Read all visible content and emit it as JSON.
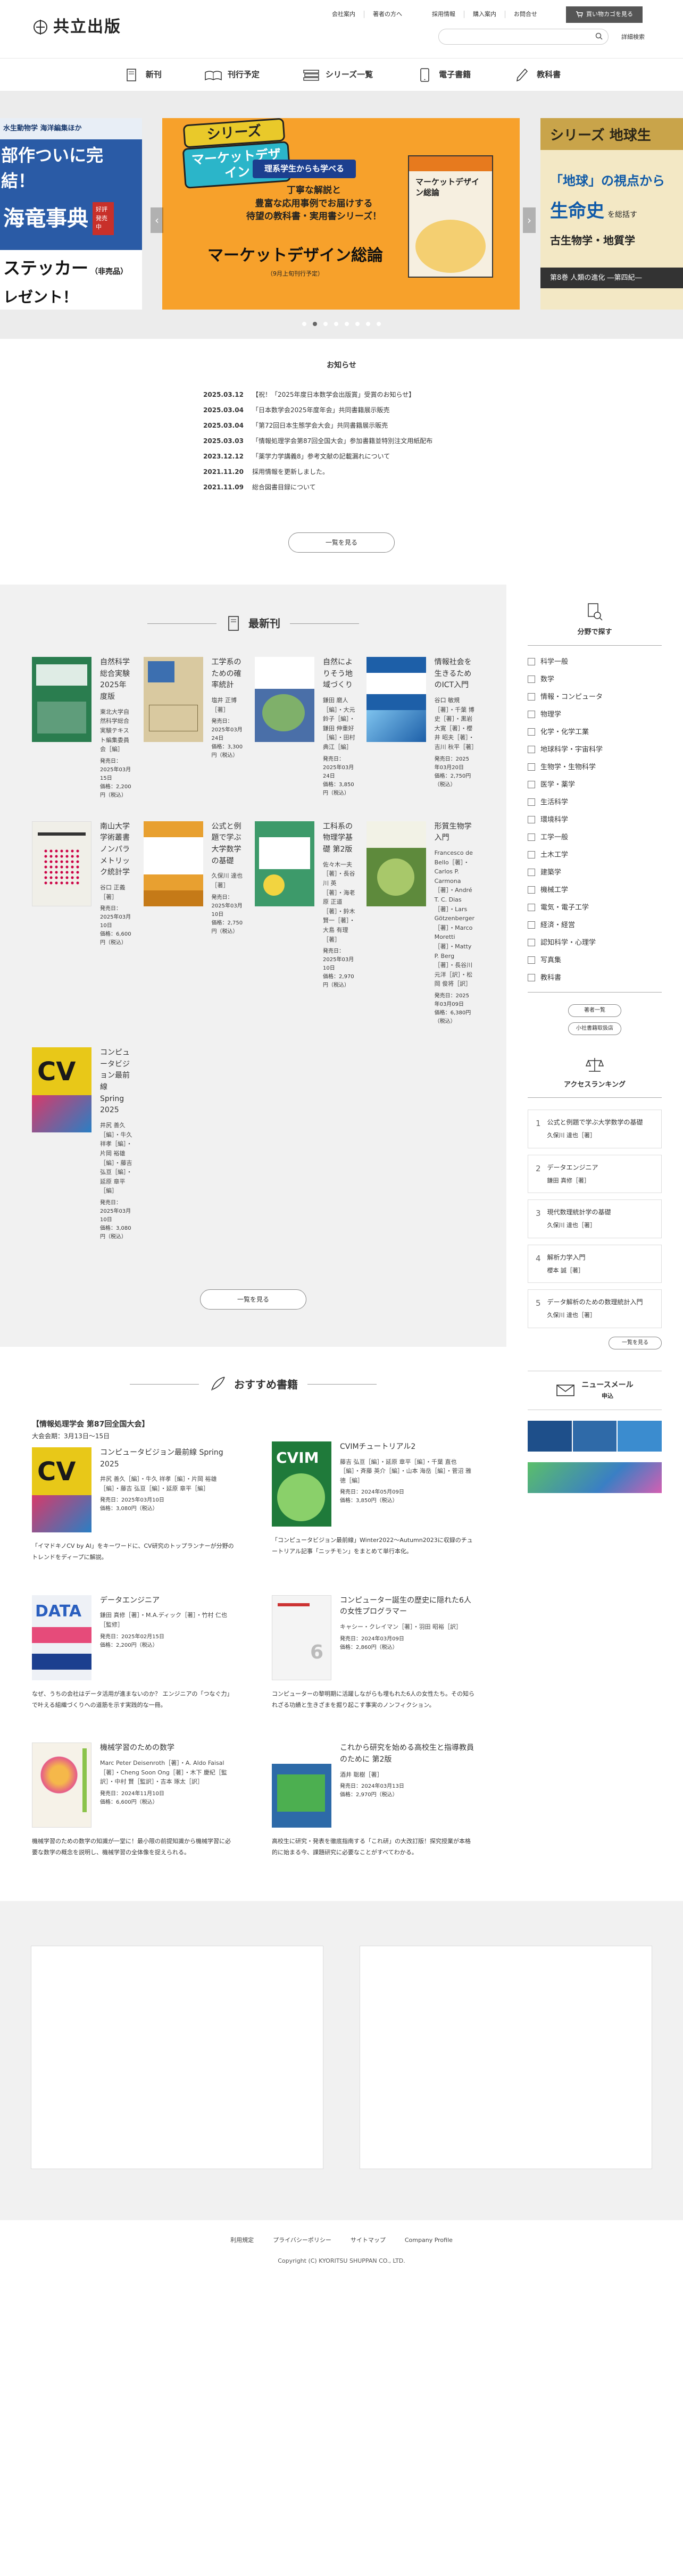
{
  "brand": {
    "name": "共立出版"
  },
  "topnav": {
    "group1": [
      "会社案内",
      "著者の方へ"
    ],
    "group2": [
      "採用情報",
      "購入案内",
      "お問合せ"
    ],
    "cart": "買い物カゴを見る"
  },
  "search": {
    "placeholder": "",
    "detail": "詳細検索"
  },
  "mainnav": [
    "新刊",
    "刊行予定",
    "シリーズ一覧",
    "電子書籍",
    "教科書"
  ],
  "slider": {
    "main": {
      "series_label": "シリーズ",
      "series_name": "マーケットデザイン",
      "tagline": "理系学生からも学べる",
      "desc1": "丁寧な解説と",
      "desc2": "豊富な応用事例でお届けする",
      "desc3": "待望の教科書・実用書シリーズ！",
      "title": "マーケットデザイン総論",
      "note": "（9月上旬刊行予定）",
      "book_title": "マーケットデザイン総論"
    },
    "left": {
      "line1": "水生動物学 海洋編集ほか",
      "line2": "部作ついに完結！",
      "line3": "海竜事典",
      "badge": "好評発売中",
      "line4": "ステッカー",
      "line4b": "（非売品）",
      "line5": "レゼント！"
    },
    "right": {
      "title": "シリーズ 地球生",
      "l1": "「地球」の視点から",
      "l2": "生命史",
      "l3": "を総括す",
      "l4": "古生物学・地質学",
      "l5": "第8巻 人類の進化 ―第四紀―"
    },
    "prev": "‹",
    "next": "›"
  },
  "news": {
    "title": "お知らせ",
    "items": [
      {
        "date": "2025.03.12",
        "text": "【祝！「2025年度日本数学会出版賞」受賞のお知らせ】"
      },
      {
        "date": "2025.03.04",
        "text": "「日本数学会2025年度年会」共同書籍展示販売"
      },
      {
        "date": "2025.03.04",
        "text": "「第72回日本生態学会大会」共同書籍展示販売"
      },
      {
        "date": "2025.03.03",
        "text": "「情報処理学会第87回全国大会」参加書籍並特別注文用紙配布"
      },
      {
        "date": "2023.12.12",
        "text": "「薬学力学講義8」参考文献の記載漏れについて"
      },
      {
        "date": "2021.11.20",
        "text": "採用情報を更新しました。"
      },
      {
        "date": "2021.11.09",
        "text": "総合図書目録について"
      }
    ],
    "more": "一覧を見る"
  },
  "newbooks": {
    "title": "最新刊",
    "more": "一覧を見る",
    "items": [
      {
        "title": "自然科学総合実験 2025年度版",
        "author": "東北大学自然科学総合実験テキスト編集委員会［編］",
        "date": "発売日：2025年03月15日",
        "price": "価格：2,200円（税込）",
        "cover": "#2a7d4f"
      },
      {
        "title": "工学系のための確率統計",
        "author": "塩井 正博［著］",
        "date": "発売日：2025年03月24日",
        "price": "価格：3,300円（税込）",
        "cover": "#d9c9a0"
      },
      {
        "title": "自然によりそう地域づくり",
        "author": "鎌田 磨人［編］・大元 鈴子［編］・鎌田 伸重好［編］・田村 典江［編］",
        "date": "発売日：2025年03月24日",
        "price": "価格：3,850円（税込）",
        "cover": "#4a6fa8"
      },
      {
        "title": "情報社会を生きるためのICT入門",
        "author": "谷口 敏規［著］・千葉 博史［著］・黒岩 大寛［著］・櫻井 昭夫［著］・吉川 秋平［著］",
        "date": "発売日：2025年03月20日",
        "price": "価格：2,750円（税込）",
        "cover": "#1d5fa8"
      },
      {
        "title": "南山大学学術叢書 ノンパラメトリック統計学",
        "author": "谷口 正義［著］",
        "date": "発売日：2025年03月10日",
        "price": "価格：6,600円（税込）",
        "cover": "#f0efe8"
      },
      {
        "title": "公式と例題で学ぶ大学数学の基礎",
        "author": "久保川 達也［著］",
        "date": "発売日：2025年03月10日",
        "price": "価格：2,750円（税込）",
        "cover": "#e8a030"
      },
      {
        "title": "工科系の物理学基礎 第2版",
        "author": "佐々木一夫［著］・長谷川 英［著］・海老原 正道［著］・鈴木 賢一［著］・大島 有理［著］",
        "date": "発売日：2025年03月10日",
        "price": "価格：2,970円（税込）",
        "cover": "#3d9a6a"
      },
      {
        "title": "形質生物学入門",
        "author": "Francesco de Bello［著］・Carlos P. Carmona［著］・André T. C. Dias［著］・Lars Götzenberger［著］・Marco Moretti［著］・Matty P. Berg［著］・長谷川 元洋［訳］・松岡 俊将［訳］",
        "date": "発売日：2025年03月09日",
        "price": "価格：6,380円（税込）",
        "cover": "#5e8a3c"
      },
      {
        "title": "コンピュータビジョン最前線 Spring 2025",
        "author": "井尻 善久［編］・牛久 祥孝［編］・片岡 裕雄［編］・藤吉 弘亘［編］・延原 章平［編］",
        "date": "発売日：2025年03月10日",
        "price": "価格：3,080円（税込）",
        "cover": "#e8c818"
      }
    ]
  },
  "sidebar": {
    "field_title": "分野で探す",
    "fields": [
      "科学一般",
      "数学",
      "情報・コンピュータ",
      "物理学",
      "化学・化学工業",
      "地球科学・宇宙科学",
      "生物学・生物科学",
      "医学・薬学",
      "生活科学",
      "環境科学",
      "工学一般",
      "土木工学",
      "建築学",
      "機械工学",
      "電気・電子工学",
      "経済・経営",
      "認知科学・心理学",
      "写真集",
      "教科書"
    ],
    "btn1": "著者一覧",
    "btn2": "小社書籍取扱店",
    "rank_title": "アクセスランキング",
    "ranks": [
      {
        "no": "1",
        "title": "公式と例題で学ぶ大学数学の基礎",
        "author": "久保川 達也［著］"
      },
      {
        "no": "2",
        "title": "データエンジニア",
        "author": "鎌田 真修［著］"
      },
      {
        "no": "3",
        "title": "現代数理統計学の基礎",
        "author": "久保川 達也［著］"
      },
      {
        "no": "4",
        "title": "解析力学入門",
        "author": "櫻本 誠［著］"
      },
      {
        "no": "5",
        "title": "データ解析のための数理統計入門",
        "author": "久保川 達也［著］"
      }
    ],
    "rank_more": "一覧を見る",
    "mail": "ニュースメール",
    "mail_sub": "申込"
  },
  "rec": {
    "title": "おすすめ書籍",
    "items": [
      {
        "headline": "【情報処理学会 第87回全国大会】",
        "sub": "大会会期：3月13日〜15日",
        "books": [
          {
            "title": "コンピュータビジョン最前線 Spring 2025",
            "author": "井尻 善久［編］・牛久 祥孝［編］・片岡 裕雄［編］・藤吉 弘亘［編］・延原 章平［編］",
            "date": "発売日：2025年03月10日",
            "price": "価格：3,080円（税込）",
            "cover": "#e8c818"
          }
        ],
        "desc": "「イマドキノCV by AI」をキーワードに、CV研究のトップランナーが分野のトレンドをディープに解説。"
      },
      {
        "headline": "",
        "sub": "",
        "books": [
          {
            "title": "CVIMチュートリアル2",
            "author": "藤吉 弘亘［編］・延原 章平［編］・千葉 直也［編］・斉藤 英介［編］・山本 海岳［編］・菅沼 雅徳［編］",
            "date": "発売日：2024年05月09日",
            "price": "価格：3,850円（税込）",
            "cover": "#1f7a3a"
          }
        ],
        "desc": "「コンピュータビジョン最前線」Winter2022〜Autumn2023に収録のチュートリアル記事「ニッチモン」をまとめて単行本化。"
      },
      {
        "headline": "",
        "sub": "",
        "books": [
          {
            "title": "データエンジニア",
            "author": "鎌田 真修［著］・M.A.ディック［著］・竹村 仁也［監修］",
            "date": "発売日：2025年02月15日",
            "price": "価格：2,200円（税込）",
            "cover": "#eef1f6"
          }
        ],
        "desc": "なぜ、うちの会社はデータ活用が進まないのか？ エンジニアの「つなぐ力」で叶える組織づくりへの道筋を示す実践的な一冊。"
      },
      {
        "headline": "",
        "sub": "",
        "books": [
          {
            "title": "コンピューター誕生の歴史に隠れた6人の女性プログラマー",
            "author": "キャシー・クレイマン［著］・羽田 昭裕［訳］",
            "date": "発売日：2024年03月09日",
            "price": "価格：2,860円（税込）",
            "cover": "#f4f4f4"
          }
        ],
        "desc": "コンピューターの黎明期に活躍しながらも埋もれた6人の女性たち。その知られざる功績と生きざまを掘り起こす事実のノンフィクション。"
      },
      {
        "headline": "",
        "sub": "",
        "books": [
          {
            "title": "機械学習のための数学",
            "author": "Marc Peter Deisenroth［著］・A. Aldo Faisal［著］・Cheng Soon Ong［著］・木下 慶紀［監訳］・中村 賢［監訳］・吉本 琢太［訳］",
            "date": "発売日：2024年11月10日",
            "price": "価格：6,600円（税込）",
            "cover": "#f6f2e8"
          }
        ],
        "desc": "機械学習のための数学の知識が一堂に！最小限の前提知識から機械学習に必要な数学の概念を説明し、機械学習の全体像を捉えられる。"
      },
      {
        "headline": "",
        "sub": "",
        "books": [
          {
            "title": "これから研究を始める高校生と指導教員のために 第2版",
            "author": "酒井 聡樹［著］",
            "date": "発売日：2024年03月13日",
            "price": "価格：2,970円（税込）",
            "cover": "#2d6aa8"
          }
        ],
        "desc": "高校生に研究・発表を徹底指南する「これ研」の大改訂版！探究授業が本格的に始まる今、課題研究に必要なことがすべてわかる。"
      }
    ]
  },
  "footer": {
    "links": [
      "利用規定",
      "プライバシーポリシー",
      "サイトマップ",
      "Company Profile"
    ],
    "copyright": "Copyright (C) KYORITSU SHUPPAN CO., LTD."
  }
}
